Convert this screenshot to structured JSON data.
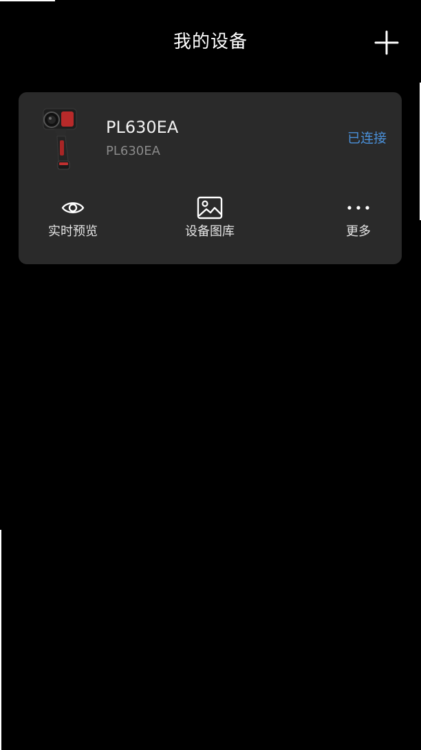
{
  "header": {
    "title": "我的设备",
    "add_icon": "plus-icon"
  },
  "device": {
    "name": "PL630EA",
    "model": "PL630EA",
    "status": "已连接",
    "status_color": "#4a90d9",
    "image": "thermal-camera-image"
  },
  "actions": [
    {
      "label": "实时预览",
      "icon": "eye-icon"
    },
    {
      "label": "设备图库",
      "icon": "gallery-icon"
    },
    {
      "label": "更多",
      "icon": "more-dots-icon"
    }
  ],
  "colors": {
    "background": "#000000",
    "card": "#2a2a2a",
    "accent": "#4a90d9"
  }
}
